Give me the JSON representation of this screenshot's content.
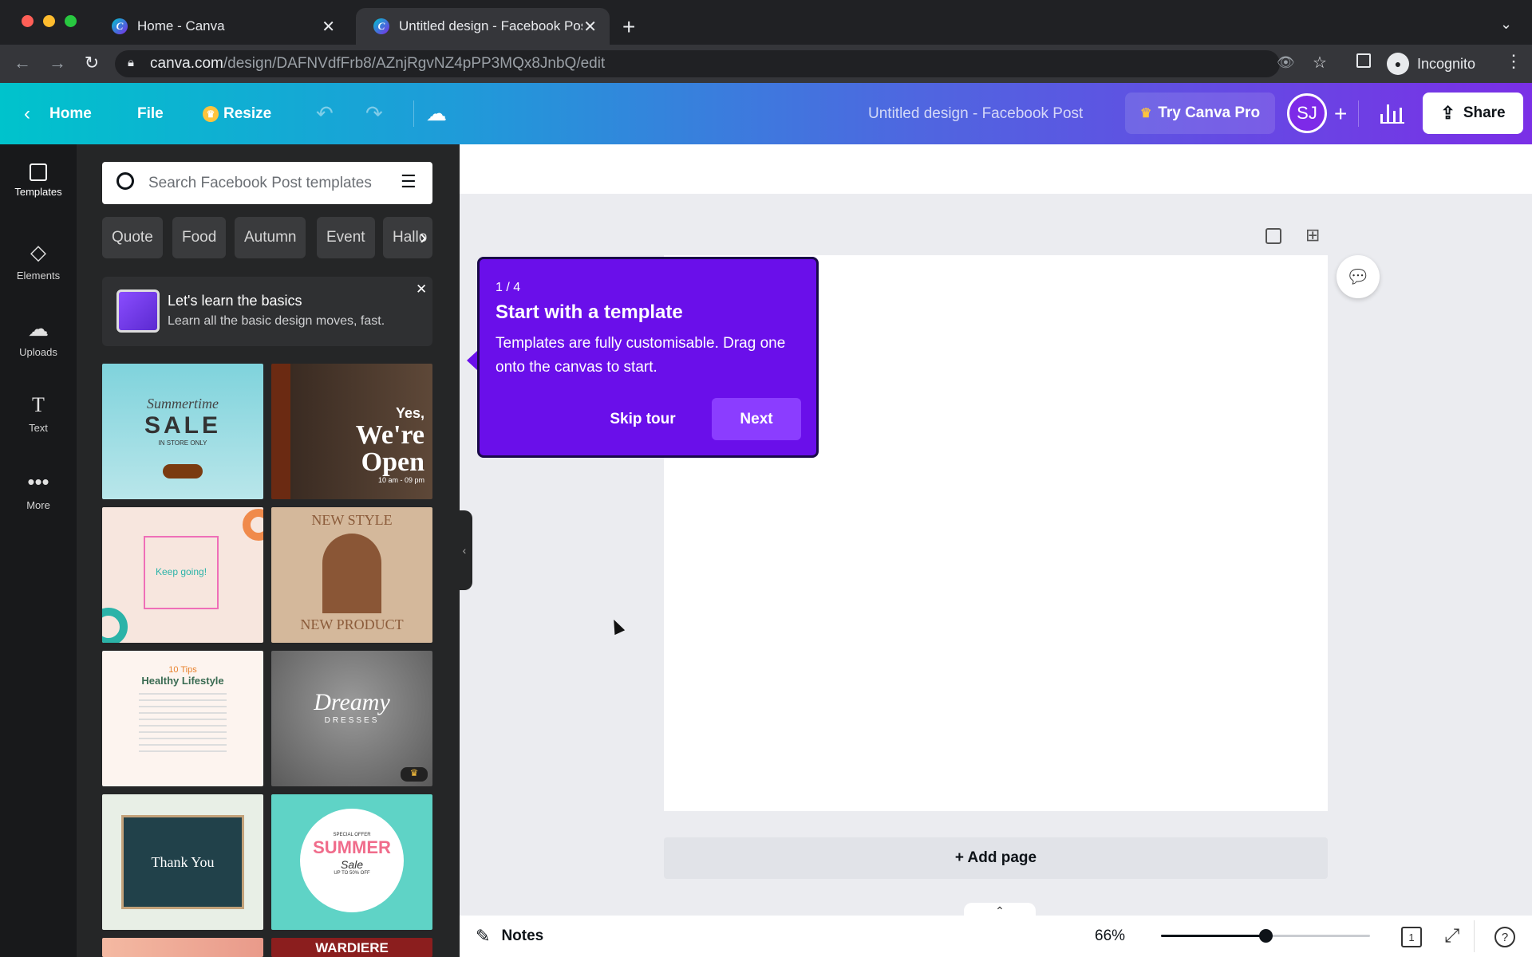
{
  "browser": {
    "tabs": [
      {
        "title": "Home - Canva"
      },
      {
        "title": "Untitled design - Facebook Post"
      }
    ],
    "url_host": "canva.com",
    "url_path": "/design/DAFNVdfFrb8/AZnjRgvNZ4pPP3MQx8JnbQ/edit",
    "incognito_label": "Incognito"
  },
  "header": {
    "home": "Home",
    "file": "File",
    "resize": "Resize",
    "design_title": "Untitled design - Facebook Post",
    "try_pro": "Try Canva Pro",
    "avatar": "SJ",
    "share": "Share"
  },
  "sidenav": {
    "items": [
      {
        "label": "Templates"
      },
      {
        "label": "Elements"
      },
      {
        "label": "Uploads"
      },
      {
        "label": "Text"
      },
      {
        "label": "More"
      }
    ]
  },
  "panel": {
    "search_placeholder": "Search Facebook Post templates",
    "chips": [
      "Quote",
      "Food",
      "Autumn",
      "Event",
      "Hallo"
    ],
    "learn_title": "Let's learn the basics",
    "learn_subtitle": "Learn all the basic design moves, fast.",
    "templates": [
      {
        "lines": [
          "Summertime",
          "SALE",
          "IN STORE ONLY"
        ]
      },
      {
        "lines": [
          "Yes,",
          "We're",
          "Open",
          "10 am - 09 pm"
        ]
      },
      {
        "lines": [
          "Keep going!"
        ]
      },
      {
        "lines": [
          "NEW STYLE",
          "NEW PRODUCT"
        ]
      },
      {
        "lines": [
          "10 Tips",
          "Healthy Lifestyle"
        ]
      },
      {
        "lines": [
          "Dreamy",
          "DRESSES"
        ]
      },
      {
        "lines": [
          "Thank You"
        ]
      },
      {
        "lines": [
          "SPECIAL OFFER",
          "SUMMER",
          "Sale",
          "UP TO 50% OFF"
        ]
      },
      {
        "lines": [
          ""
        ]
      },
      {
        "lines": [
          "WARDIERE"
        ]
      }
    ]
  },
  "tour": {
    "step": "1 / 4",
    "title": "Start with a template",
    "body": "Templates are fully customisable. Drag one onto the canvas to start.",
    "skip": "Skip tour",
    "next": "Next"
  },
  "canvas": {
    "add_page": "+ Add page"
  },
  "footer": {
    "notes": "Notes",
    "zoom": "66%",
    "zoom_fraction": 0.5,
    "page_count": "1"
  },
  "colors": {
    "brand_purple": "#8b3dff",
    "tour_bg": "#6a0fea",
    "header_start": "#00c3cc",
    "header_end": "#7a2fe6"
  }
}
